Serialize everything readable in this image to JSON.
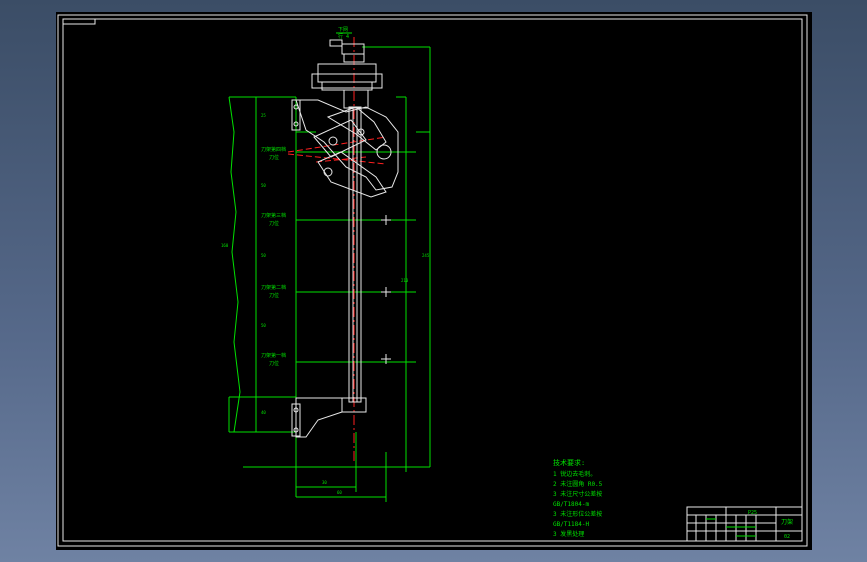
{
  "drawing": {
    "top_label": "下网",
    "top_label_sub": "行 4",
    "labels": [
      {
        "line1": "刀架第四档",
        "line2": "刀位"
      },
      {
        "line1": "刀架第三档",
        "line2": "刀位"
      },
      {
        "line1": "刀架第二档",
        "line2": "刀位"
      },
      {
        "line1": "刀架第一档",
        "line2": "刀位"
      }
    ],
    "dims": {
      "d25": "25",
      "d50a": "50",
      "d50b": "50",
      "d50c": "50",
      "d40": "40",
      "d160": "160",
      "d210": "210",
      "d245": "245",
      "d30": "30",
      "d60": "60"
    },
    "notes": {
      "title": "技术要求:",
      "items": [
        "1  锐边去毛刺。",
        "2  未注圆角 R0.5",
        "3  未注尺寸公差按",
        "GB/T1804-m",
        "3  未注形位公差按",
        "GB/T1184-H",
        "3  发黑处理"
      ]
    },
    "title_block": {
      "scale": "P25",
      "name": "刀架",
      "sheet": "02"
    }
  }
}
